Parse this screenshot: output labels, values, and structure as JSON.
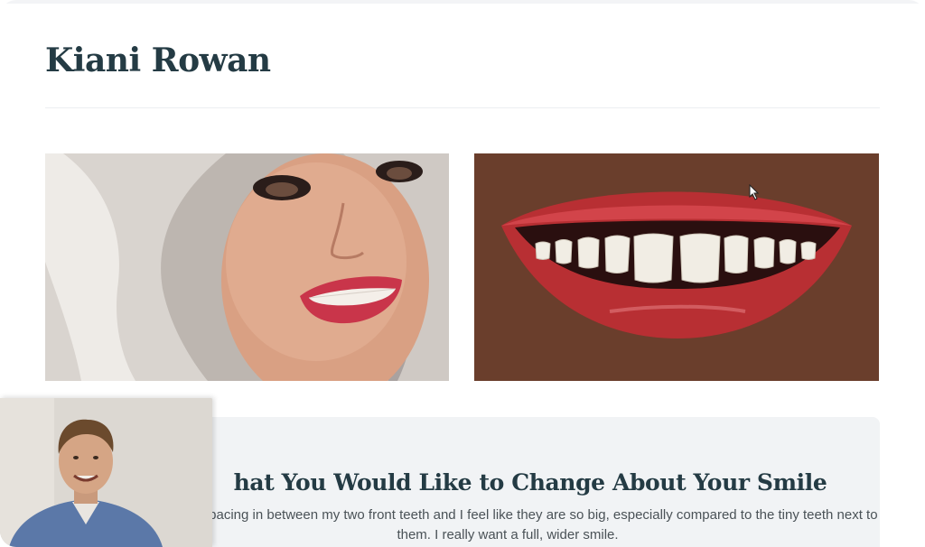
{
  "patient": {
    "name": "Kiani Rowan"
  },
  "photos": {
    "face_icon": "portrait-photo",
    "smile_icon": "smile-closeup-photo"
  },
  "smile_section": {
    "heading": "hat You Would Like to Change About Your Smile",
    "text": "n't like the spacing in between my two front teeth and I feel like they are so big, especially compared to the tiny teeth next to them. I really want a full, wider smile."
  },
  "video_call": {
    "icon": "webcam-participant"
  },
  "colors": {
    "heading": "#243b44",
    "card_background": "#f1f3f5",
    "body_text": "#4a5257"
  }
}
